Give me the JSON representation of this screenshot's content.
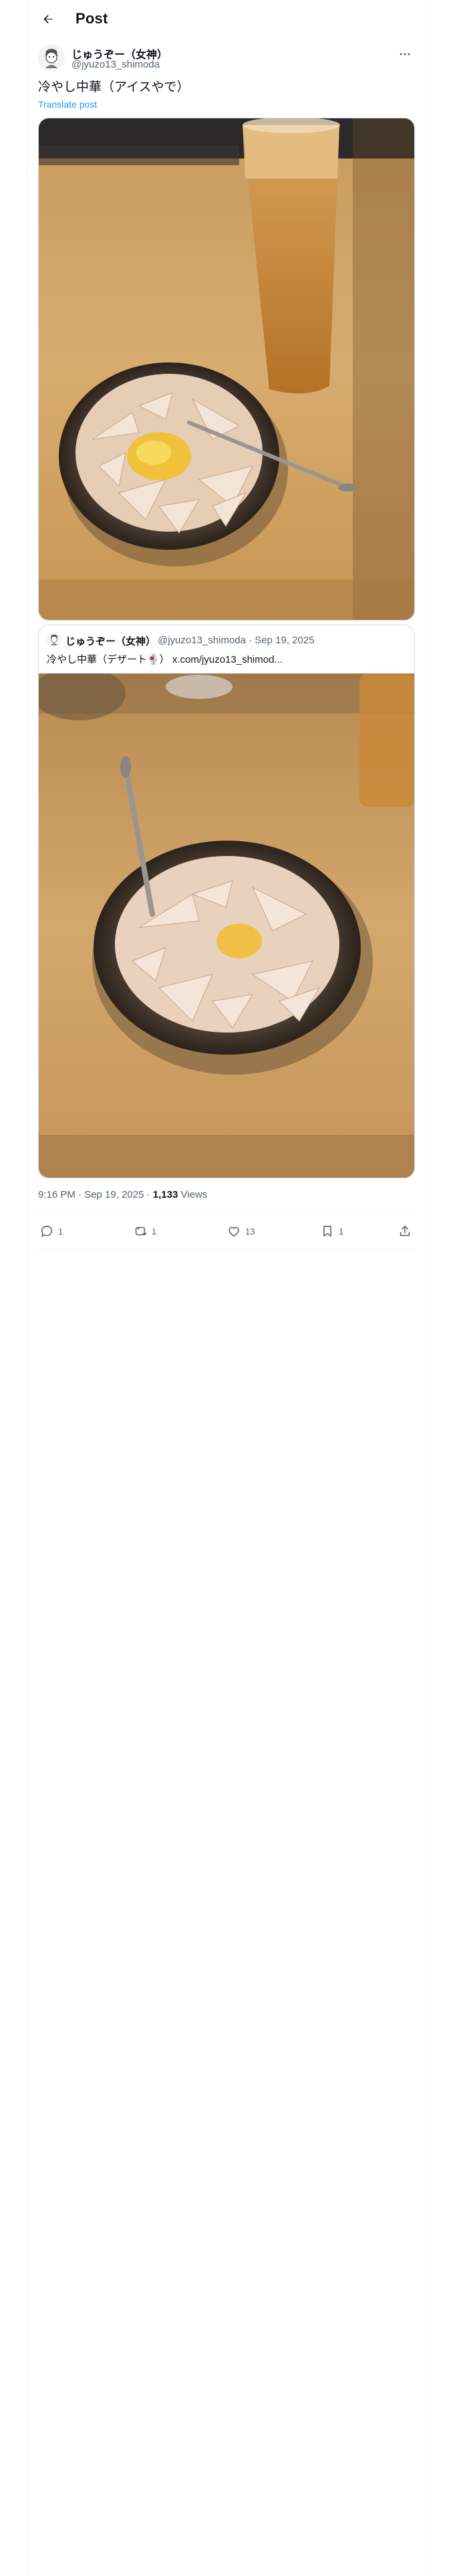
{
  "header": {
    "title": "Post"
  },
  "author": {
    "name": "じゅうぞー（女神）",
    "handle": "@jyuzo13_shimoda"
  },
  "post": {
    "text": "冷やし中華（アイスやで）",
    "translate_label": "Translate post"
  },
  "quote": {
    "name": "じゅうぞー（女神）",
    "meta": "@jyuzo13_shimoda · Sep 19, 2025",
    "text": "冷やし中華（デザート🍨）",
    "link": "x.com/jyuzo13_shimod..."
  },
  "stats": {
    "time": "9:16 PM · Sep 19, 2025 · ",
    "views_count": "1,133",
    "views_label": " Views"
  },
  "actions": {
    "replies": "1",
    "reposts": "1",
    "likes": "13",
    "bookmarks": "1"
  },
  "colors": {
    "accent": "#1d9bf0",
    "text": "#0f1419",
    "secondary": "#536471",
    "border": "#cfd9de"
  },
  "icons": [
    "back-arrow-icon",
    "more-icon",
    "reply-icon",
    "repost-icon",
    "like-icon",
    "bookmark-icon",
    "share-icon"
  ]
}
